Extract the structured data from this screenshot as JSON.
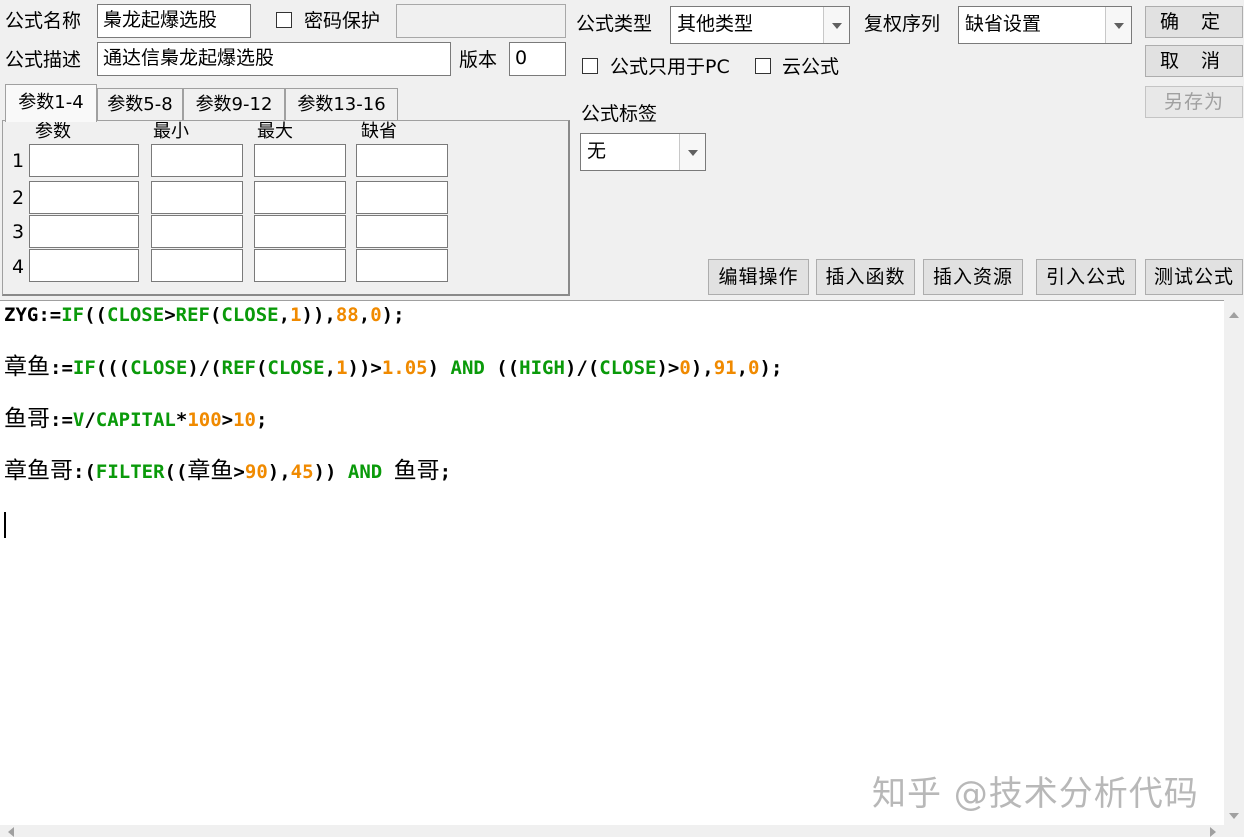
{
  "form": {
    "name_label": "公式名称",
    "name_value": "梟龙起爆选股",
    "password_label": "密码保护",
    "password_value": "",
    "desc_label": "公式描述",
    "desc_value": "通达信梟龙起爆选股",
    "version_label": "版本",
    "version_value": "0",
    "type_label": "公式类型",
    "type_value": "其他类型",
    "fuquan_label": "复权序列",
    "fuquan_value": "缺省设置",
    "pc_only_label": "公式只用于PC",
    "cloud_label": "云公式",
    "tag_label": "公式标签",
    "tag_value": "无"
  },
  "buttons": {
    "ok": "确 定",
    "cancel": "取 消",
    "save_as": "另存为",
    "edit_ops": "编辑操作",
    "insert_func": "插入函数",
    "insert_res": "插入资源",
    "import_formula": "引入公式",
    "test_formula": "测试公式"
  },
  "tabs": [
    "参数1-4",
    "参数5-8",
    "参数9-12",
    "参数13-16"
  ],
  "params": {
    "headers": [
      "参数",
      "最小",
      "最大",
      "缺省"
    ],
    "rows": [
      "1",
      "2",
      "3",
      "4"
    ]
  },
  "code": {
    "line1": [
      "ZYG:=",
      "IF",
      "((",
      "CLOSE",
      ">",
      "REF",
      "(",
      "CLOSE",
      ",",
      "1",
      ")),",
      "88",
      ",",
      "0",
      ");"
    ],
    "line2": [
      "章鱼",
      ":=",
      "IF",
      "(((",
      "CLOSE",
      ")/(",
      "REF",
      "(",
      "CLOSE",
      ",",
      "1",
      "))>",
      "1.05",
      ") ",
      "AND",
      " ((",
      "HIGH",
      ")/(",
      "CLOSE",
      ")>",
      "0",
      "),",
      "91",
      ",",
      "0",
      ");"
    ],
    "line3": [
      "鱼哥",
      ":=",
      "V",
      "/",
      "CAPITAL",
      "*",
      "100",
      ">",
      "10",
      ";"
    ],
    "line4": [
      "章鱼哥",
      ":(",
      "FILTER",
      "((",
      "章鱼",
      ">",
      "90",
      "),",
      "45",
      ")) ",
      "AND",
      " ",
      "鱼哥",
      ";"
    ]
  },
  "watermark": "知乎 @技术分析代码"
}
